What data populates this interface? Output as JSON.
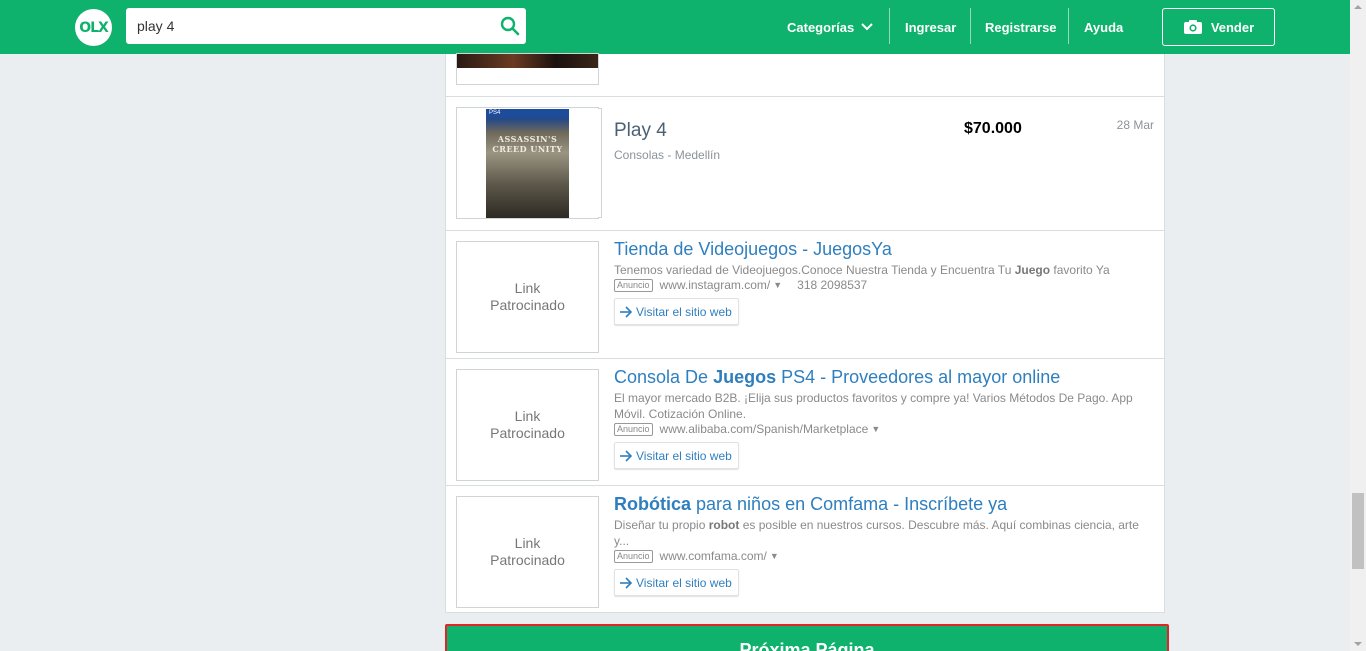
{
  "header": {
    "logo_text": "OLX",
    "search": {
      "value": "play 4",
      "placeholder": ""
    },
    "nav": {
      "categorias": "Categorías",
      "ingresar": "Ingresar",
      "registrarse": "Registrarse",
      "ayuda": "Ayuda",
      "vender": "Vender"
    }
  },
  "listings": [
    {
      "title": "Play 4",
      "meta": "Consolas - Medellín",
      "price": "$70.000",
      "date": "28 Mar",
      "image_text": "ASSASSIN'S CREED UNITY"
    }
  ],
  "ads": [
    {
      "thumb_line1": "Link",
      "thumb_line2": "Patrocinado",
      "title_part1": "Tienda de Videojuegos - JuegosYa",
      "desc_part1": "Tenemos variedad de Videojuegos.Conoce Nuestra Tienda y Encuentra Tu ",
      "desc_bold1": "Juego",
      "desc_part2": " favorito Ya",
      "badge": "Anuncio",
      "url": "www.instagram.com/",
      "phone": "318 2098537",
      "visit": "Visitar el sitio web"
    },
    {
      "thumb_line1": "Link",
      "thumb_line2": "Patrocinado",
      "title_part1": "Consola De ",
      "title_bold": "Juegos",
      "title_part2": " PS4 - Proveedores al mayor online",
      "desc": "El mayor mercado B2B. ¡Elija sus productos favoritos y compre ya! Varios Métodos De Pago. App Móvil. Cotización Online.",
      "badge": "Anuncio",
      "url": "www.alibaba.com/Spanish/Marketplace",
      "visit": "Visitar el sitio web"
    },
    {
      "thumb_line1": "Link",
      "thumb_line2": "Patrocinado",
      "title_bold": "Robótica",
      "title_part2": " para niños en Comfama - Inscríbete ya",
      "desc_part1": "Diseñar tu propio ",
      "desc_bold1": "robot",
      "desc_part2": " es posible en nuestros cursos. Descubre más. Aquí combinas ciencia, arte y...",
      "badge": "Anuncio",
      "url": "www.comfama.com/",
      "visit": "Visitar el sitio web"
    }
  ],
  "next_page_label": "Próxima Página",
  "colors": {
    "brand_green": "#0fb26c",
    "link_blue": "#2f7fbf",
    "highlight_red": "#e0242a"
  }
}
